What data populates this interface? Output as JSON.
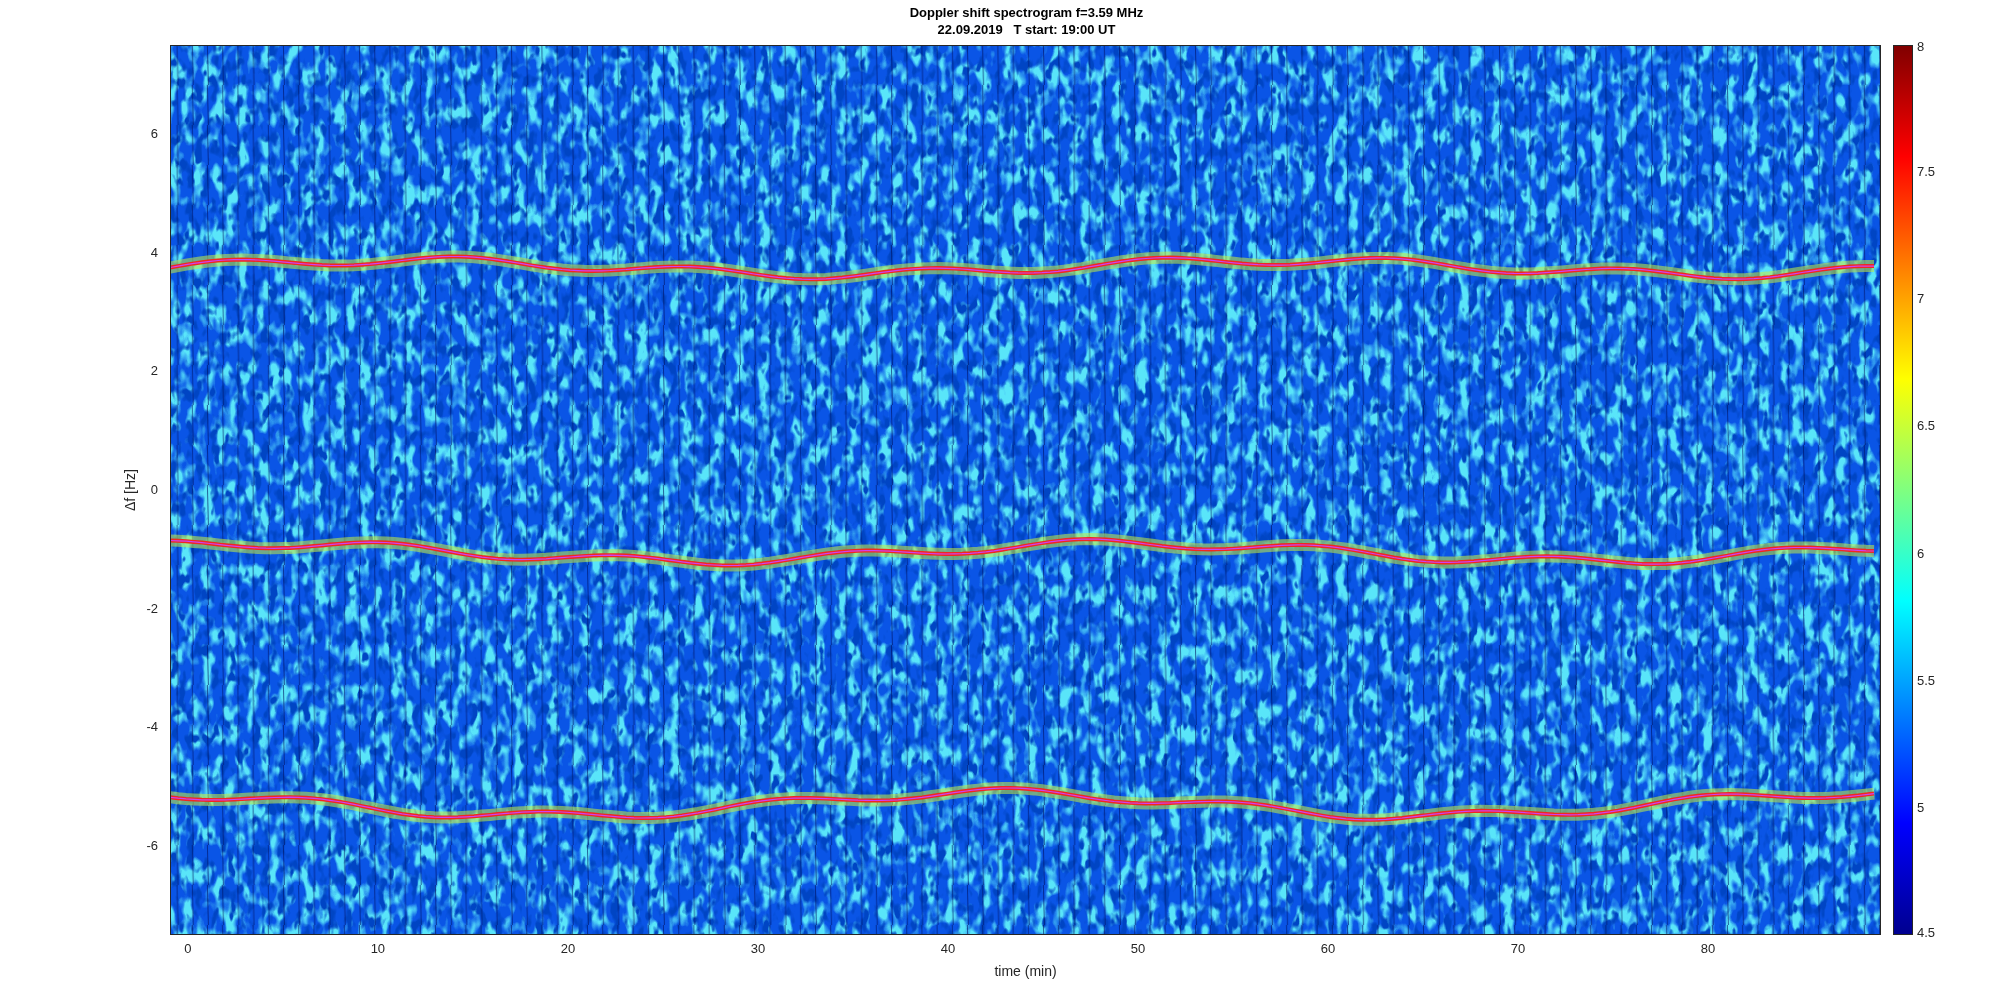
{
  "figure": {
    "title_lines": [
      "Doppler shift spectrogram f=3.59 MHz",
      "22.09.2019   T start: 19:00 UT"
    ],
    "axes": {
      "xlabel": "time (min)",
      "ylabel": "Δf [Hz]",
      "xticks": [
        "0",
        "10",
        "20",
        "30",
        "40",
        "50",
        "60",
        "70",
        "80"
      ],
      "yticks": [
        "6",
        "4",
        "2",
        "0",
        "-2",
        "-4",
        "-6"
      ]
    },
    "colorbar": {
      "ticks": [
        "8",
        "7.5",
        "7",
        "6.5",
        "6",
        "5.5",
        "5",
        "4.5"
      ]
    }
  }
}
